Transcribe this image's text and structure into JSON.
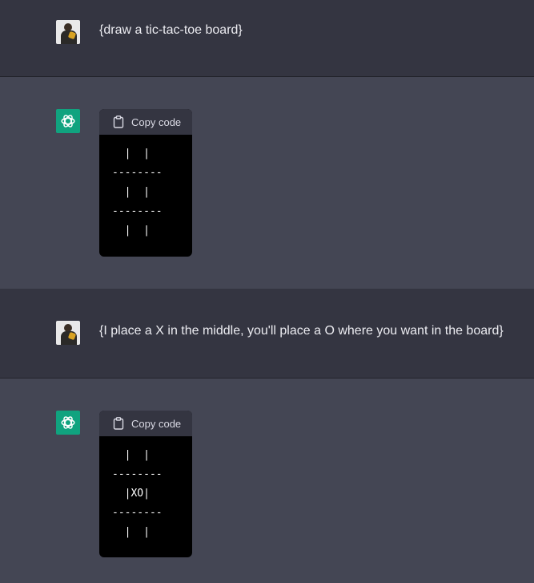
{
  "conversation": {
    "messages": [
      {
        "role": "user",
        "text": "{draw a tic-tac-toe board}"
      },
      {
        "role": "assistant",
        "copy_label": "Copy code",
        "code": "  |  |\n--------\n  |  |\n--------\n  |  |"
      },
      {
        "role": "user",
        "text": "{I place a X in the middle, you'll place a O where you want in the board}"
      },
      {
        "role": "assistant",
        "copy_label": "Copy code",
        "code": "  |  |\n--------\n  |XO|\n--------\n  |  |"
      }
    ]
  },
  "icons": {
    "user_avatar": "user-avatar",
    "assistant_avatar": "openai-logo-icon",
    "copy": "clipboard-icon"
  },
  "colors": {
    "user_bg": "#343541",
    "assistant_bg": "#444654",
    "assistant_avatar_bg": "#10a37f",
    "code_bg": "#000000",
    "code_header_bg": "#343541",
    "text": "#ececf1"
  }
}
